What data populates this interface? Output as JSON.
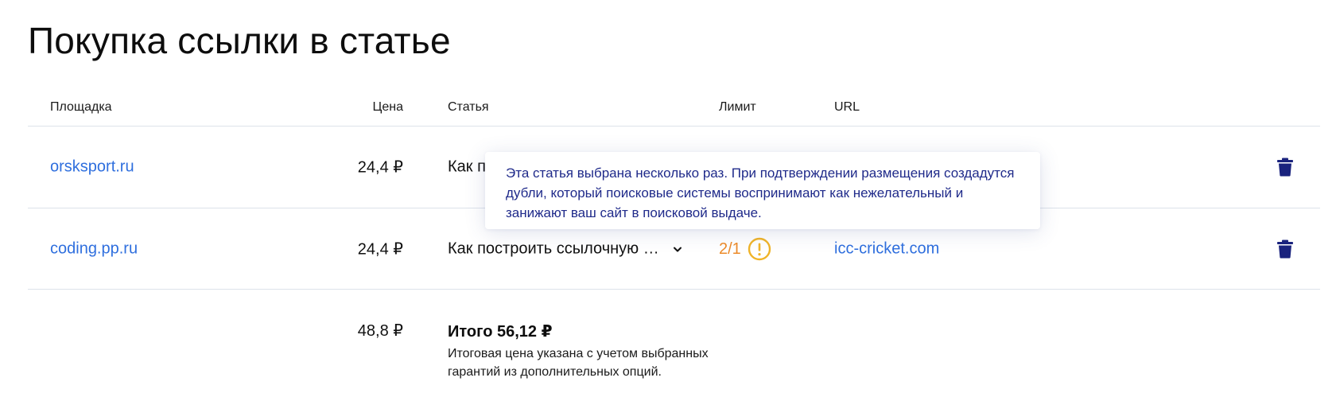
{
  "page": {
    "title": "Покупка ссылки в статье"
  },
  "table": {
    "headers": {
      "platform": "Площадка",
      "price": "Цена",
      "article": "Статья",
      "limit": "Лимит",
      "url": "URL"
    },
    "rows": [
      {
        "platform": "orsksport.ru",
        "price": "24,4 ₽",
        "article": "Как п",
        "limit": "",
        "url": ""
      },
      {
        "platform": "coding.pp.ru",
        "price": "24,4 ₽",
        "article": "Как построить ссылочную …",
        "limit": "2/1",
        "url": "icc-cricket.com"
      }
    ]
  },
  "totals": {
    "price": "48,8 ₽",
    "label": "Итого 56,12 ₽",
    "note": "Итоговая цена указана с учетом выбранных гарантий из дополнительных опций."
  },
  "tooltip": {
    "text": "Эта статья выбрана несколько раз. При подтверждении размещения создадутся дубли, который поисковые системы воспринимают как нежелательный и занижают ваш сайт в поисковой выдаче."
  },
  "icons": {
    "chevron": "chevron-down-icon",
    "warning": "warning-circle-icon",
    "trash": "trash-icon"
  },
  "colors": {
    "link": "#2f6fde",
    "warning": "#ec8b2a",
    "warning_icon": "#f0b429",
    "tooltip_text": "#1f2a8a",
    "trash": "#1a237e"
  }
}
